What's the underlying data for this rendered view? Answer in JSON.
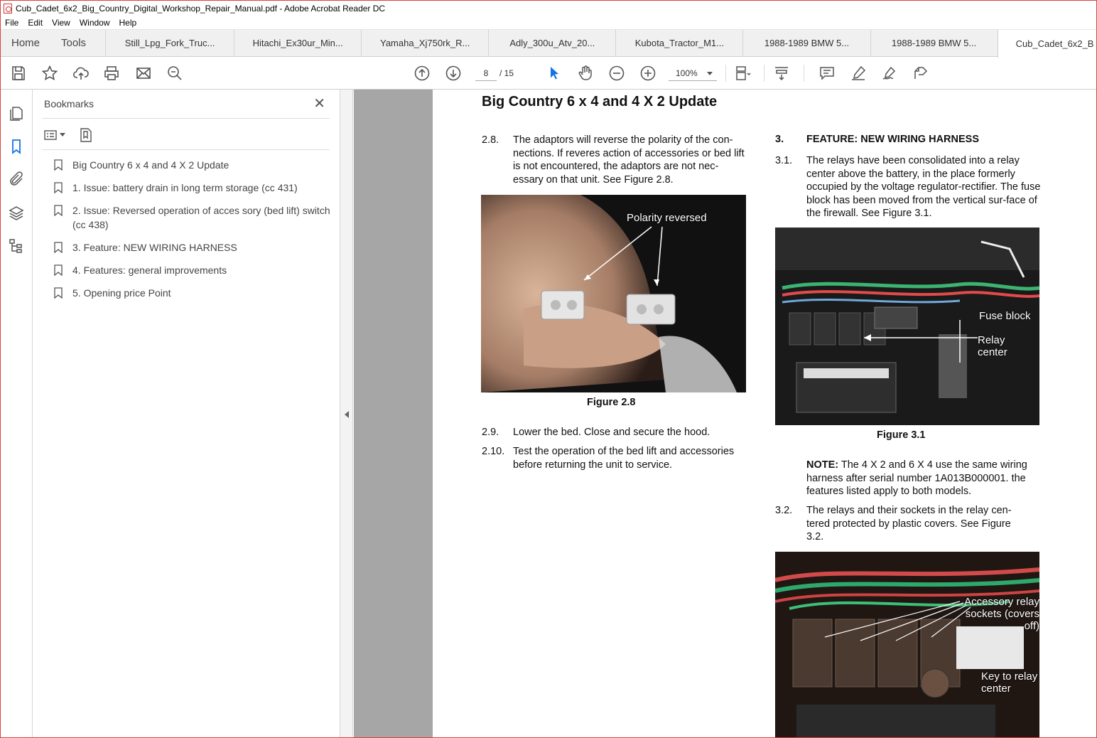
{
  "window": {
    "title": "Cub_Cadet_6x2_Big_Country_Digital_Workshop_Repair_Manual.pdf - Adobe Acrobat Reader DC"
  },
  "menu": [
    "File",
    "Edit",
    "View",
    "Window",
    "Help"
  ],
  "tabs": {
    "home": "Home",
    "tools": "Tools",
    "docs": [
      "Still_Lpg_Fork_Truc...",
      "Hitachi_Ex30ur_Min...",
      "Yamaha_Xj750rk_R...",
      "Adly_300u_Atv_20...",
      "Kubota_Tractor_M1...",
      "1988-1989 BMW 5...",
      "1988-1989 BMW 5...",
      "Cub_Cadet_6x2_B"
    ]
  },
  "toolbar": {
    "page_current": "8",
    "page_total": "/ 15",
    "zoom": "100%"
  },
  "bookmarks": {
    "header": "Bookmarks",
    "items": [
      "Big Country 6 x 4 and 4 X 2 Update",
      "1. Issue: battery drain in long term storage (cc 431)",
      "2. Issue: Reversed operation of acces sory (bed lift) switch (cc 438)",
      "3. Feature: NEW WIRING HARNESS",
      "4. Features: general improvements",
      "5. Opening price Point"
    ]
  },
  "document": {
    "title": "Big Country 6 x 4 and 4 X 2 Update",
    "left": {
      "p28_num": "2.8.",
      "p28_text": "The adaptors will reverse the polarity of the con-nections.  If reveres action of accessories or bed lift is not encountered, the adaptors are not nec-essary on that unit. See Figure 2.8.",
      "fig28_label": "Polarity reversed",
      "fig28_caption": "Figure 2.8",
      "p29_num": "2.9.",
      "p29_text": "Lower the bed.  Close and secure the hood.",
      "p210_num": "2.10.",
      "p210_text": "Test the operation of the bed lift and accessories before returning the unit to service."
    },
    "right": {
      "h3_num": "3.",
      "h3_text": "FEATURE:  NEW WIRING HARNESS",
      "p31_num": "3.1.",
      "p31_text": "The relays have been consolidated into a relay center above the battery, in the place formerly occupied by the voltage regulator-rectifier.  The fuse block has been moved from the vertical sur-face of the firewall.   See Figure 3.1.",
      "fig31_label_fuse": "Fuse block",
      "fig31_label_relay": "Relay center",
      "fig31_caption": "Figure 3.1",
      "note_bold": "NOTE:",
      "note_text": " The 4 X 2 and 6 X 4 use the same wiring harness after serial number 1A013B000001. the features listed apply to both models.",
      "p32_num": "3.2.",
      "p32_text": "The relays and their sockets in the relay cen-tered protected by plastic covers. See Figure 3.2.",
      "fig32_label_acc": "Accessory relay sockets (covers off)",
      "fig32_label_key": "Key to relay center"
    }
  },
  "colors": {
    "window_border": "#d9443f",
    "doc_bg": "#a6a6a6",
    "accent": "#1473e6"
  }
}
